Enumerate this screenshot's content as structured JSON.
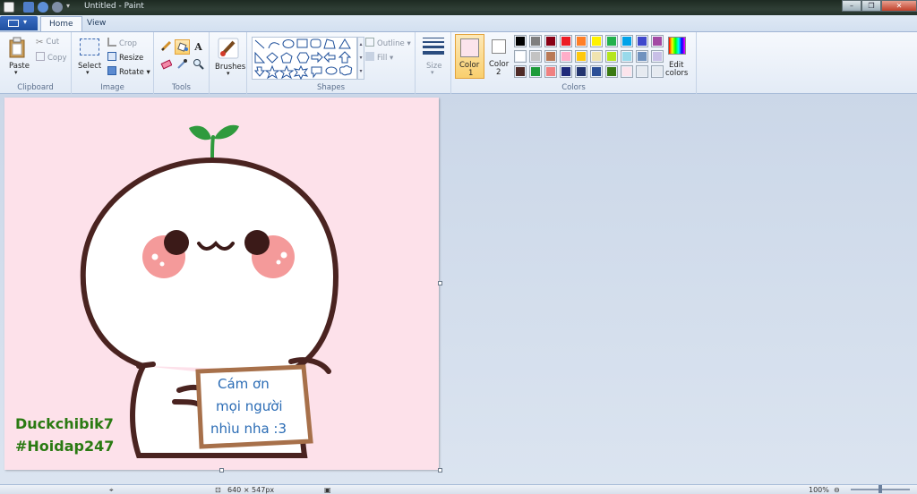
{
  "titlebar": {
    "title": "Untitled - Paint"
  },
  "tabs": [
    {
      "label": "Home"
    },
    {
      "label": "View"
    }
  ],
  "clipboard": {
    "paste": "Paste",
    "cut": "Cut",
    "copy": "Copy",
    "label": "Clipboard"
  },
  "image": {
    "select": "Select",
    "crop": "Crop",
    "resize": "Resize",
    "rotate": "Rotate",
    "label": "Image"
  },
  "tools": {
    "label": "Tools",
    "text_tool_glyph": "A"
  },
  "brushes": {
    "label": "Brushes"
  },
  "shapes": {
    "outline": "Outline",
    "fill": "Fill",
    "label": "Shapes"
  },
  "size": {
    "label": "Size"
  },
  "colors": {
    "color1": "Color 1",
    "color1_line1": "Color",
    "color1_line2": "1",
    "color2_line1": "Color",
    "color2_line2": "2",
    "edit_line1": "Edit",
    "edit_line2": "colors",
    "label": "Colors",
    "color1_value": "#fce4ec",
    "color2_value": "#ffffff",
    "palette": [
      "#000000",
      "#7f7f7f",
      "#880015",
      "#ed1c24",
      "#ff7f27",
      "#fff200",
      "#22b14c",
      "#00a2e8",
      "#3f48cc",
      "#a349a4",
      "#ffffff",
      "#c3c3c3",
      "#b97a57",
      "#ffaec9",
      "#ffc90e",
      "#efe4b0",
      "#b5e61d",
      "#99d9ea",
      "#7092be",
      "#c8bfe7",
      "#4f2a26",
      "#1c9b3a",
      "#f08080",
      "#1f2a7a",
      "#23346f",
      "#2a4e96",
      "#3a7a12",
      "#fce4ec",
      "#e6eaf0",
      "#e6eaf0"
    ]
  },
  "drawing": {
    "note_line1": "Cám ơn",
    "note_line2": "mọi người",
    "note_line3": "nhìu nha :3",
    "signature_line1": "Duckchibik7",
    "signature_line2": "#Hoidap247",
    "background": "#fde1ea",
    "outline_color": "#4a2320",
    "cheek_color": "#f49a9a",
    "sprout_color": "#2f9a3d",
    "note_border": "#a7704a",
    "note_text_color": "#2b6cb5",
    "signature_color": "#2a7a12"
  },
  "status": {
    "size_text": "640 × 547px",
    "zoom": "100%"
  }
}
